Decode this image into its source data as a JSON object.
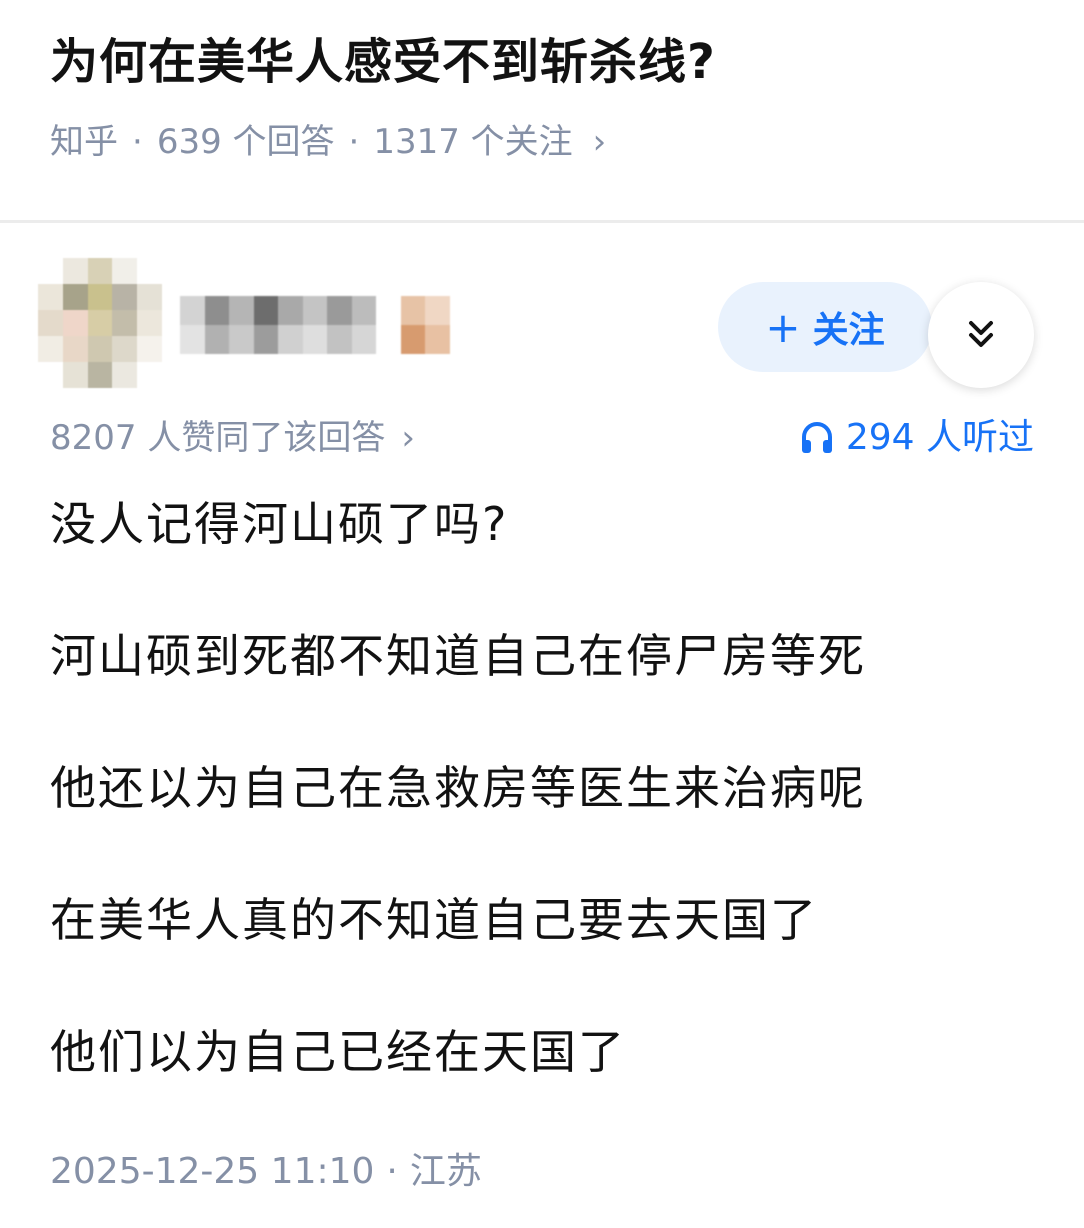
{
  "question": {
    "title": "为何在美华人感受不到斩杀线?",
    "source": "知乎",
    "answers_count": "639 个回答",
    "followers_count": "1317 个关注",
    "separator": "·",
    "chevron": "›"
  },
  "answer": {
    "follow_label": "+ 关注",
    "follow_plus": "+",
    "follow_text": "关注",
    "expand_icon": "double-chevron-down-icon",
    "votes": "8207 人赞同了该回答",
    "listen": "294 人听过",
    "paragraphs": [
      "没人记得河山硕了吗?",
      "河山硕到死都不知道自己在停尸房等死",
      "他还以为自己在急救房等医生来治病呢",
      "在美华人真的不知道自己要去天国了",
      "他们以为自己已经在天国了"
    ],
    "date": "2025-12-25 11:10",
    "location": "江苏"
  },
  "colors": {
    "accent": "#1772f6",
    "meta_gray": "#8590a6",
    "text": "#121212",
    "follow_bg": "#e9f2fd"
  }
}
